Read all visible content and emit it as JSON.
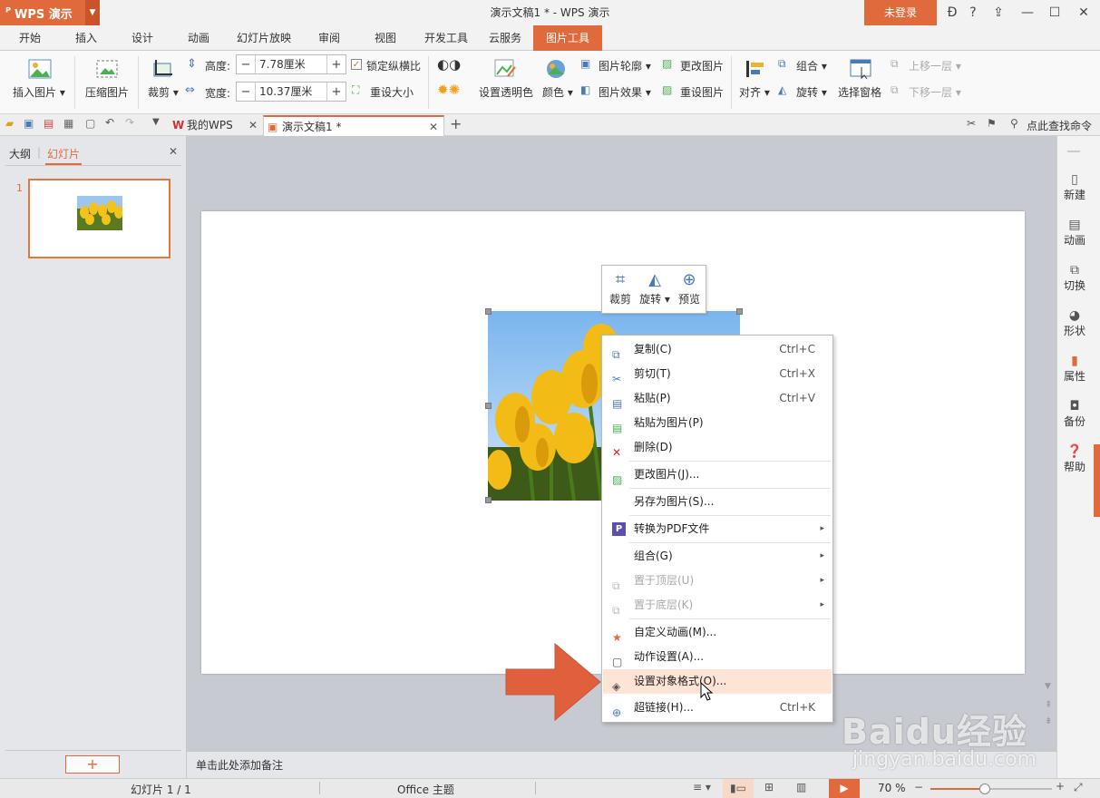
{
  "app": {
    "logo": "WPS 演示",
    "title": "演示文稿1 * - WPS 演示",
    "login": "未登录"
  },
  "menu_tabs": [
    "开始",
    "插入",
    "设计",
    "动画",
    "幻灯片放映",
    "审阅",
    "视图",
    "开发工具",
    "云服务",
    "图片工具"
  ],
  "ribbon": {
    "insert_picture": "插入图片",
    "compress_picture": "压缩图片",
    "crop": "裁剪",
    "height_label": "高度:",
    "height_value": "7.78厘米",
    "width_label": "宽度:",
    "width_value": "10.37厘米",
    "lock_ratio": "锁定纵横比",
    "reset_size": "重设大小",
    "set_transparent": "设置透明色",
    "color": "颜色",
    "picture_outline": "图片轮廓",
    "picture_effect": "图片效果",
    "change_picture": "更改图片",
    "reset_picture": "重设图片",
    "align": "对齐",
    "group": "组合",
    "rotate": "旋转",
    "selection_pane": "选择窗格",
    "bring_forward": "上移一层",
    "send_backward": "下移一层"
  },
  "doc_tabs": {
    "mywps": "我的WPS",
    "doc": "演示文稿1 *",
    "search": "点此查找命令"
  },
  "left_panel": {
    "tab_outline": "大纲",
    "tab_slides": "幻灯片",
    "slide_number": "1",
    "add": "+"
  },
  "right_panel": [
    "新建",
    "动画",
    "切换",
    "形状",
    "属性",
    "备份",
    "帮助"
  ],
  "mini_toolbar": {
    "crop": "裁剪",
    "rotate": "旋转",
    "preview": "预览"
  },
  "context_menu": [
    {
      "label": "复制(C)",
      "shortcut": "Ctrl+C"
    },
    {
      "label": "剪切(T)",
      "shortcut": "Ctrl+X"
    },
    {
      "label": "粘贴(P)",
      "shortcut": "Ctrl+V"
    },
    {
      "label": "粘贴为图片(P)",
      "shortcut": ""
    },
    {
      "label": "删除(D)",
      "shortcut": ""
    },
    {
      "label": "更改图片(J)...",
      "shortcut": ""
    },
    {
      "label": "另存为图片(S)...",
      "shortcut": ""
    },
    {
      "label": "转换为PDF文件",
      "shortcut": ""
    },
    {
      "label": "组合(G)",
      "shortcut": ""
    },
    {
      "label": "置于顶层(U)",
      "shortcut": ""
    },
    {
      "label": "置于底层(K)",
      "shortcut": ""
    },
    {
      "label": "自定义动画(M)...",
      "shortcut": ""
    },
    {
      "label": "动作设置(A)...",
      "shortcut": ""
    },
    {
      "label": "设置对象格式(O)...",
      "shortcut": ""
    },
    {
      "label": "超链接(H)...",
      "shortcut": "Ctrl+K"
    }
  ],
  "notes_placeholder": "单击此处添加备注",
  "status": {
    "slide_info": "幻灯片 1 / 1",
    "theme": "Office 主题",
    "zoom": "70 %",
    "zoom_fraction": 0.45
  },
  "watermark": {
    "logo": "Baidu经验",
    "url": "jingyan.baidu.com"
  },
  "colors": {
    "accent": "#e06a3c",
    "highlight": "#fde4d4",
    "arrow": "#e0603e"
  }
}
